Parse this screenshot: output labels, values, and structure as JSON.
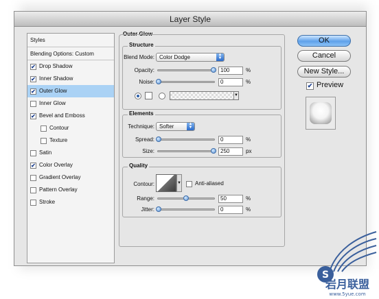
{
  "window": {
    "title": "Layer Style"
  },
  "styles_panel": {
    "header": "Styles",
    "blending_options": "Blending Options: Custom",
    "items": [
      {
        "label": "Drop Shadow",
        "checked": true,
        "indent": false,
        "selected": false
      },
      {
        "label": "Inner Shadow",
        "checked": true,
        "indent": false,
        "selected": false
      },
      {
        "label": "Outer Glow",
        "checked": true,
        "indent": false,
        "selected": true
      },
      {
        "label": "Inner Glow",
        "checked": false,
        "indent": false,
        "selected": false
      },
      {
        "label": "Bevel and Emboss",
        "checked": true,
        "indent": false,
        "selected": false
      },
      {
        "label": "Contour",
        "checked": false,
        "indent": true,
        "selected": false
      },
      {
        "label": "Texture",
        "checked": false,
        "indent": true,
        "selected": false
      },
      {
        "label": "Satin",
        "checked": false,
        "indent": false,
        "selected": false
      },
      {
        "label": "Color Overlay",
        "checked": true,
        "indent": false,
        "selected": false
      },
      {
        "label": "Gradient Overlay",
        "checked": false,
        "indent": false,
        "selected": false
      },
      {
        "label": "Pattern Overlay",
        "checked": false,
        "indent": false,
        "selected": false
      },
      {
        "label": "Stroke",
        "checked": false,
        "indent": false,
        "selected": false
      }
    ]
  },
  "outer_glow": {
    "title": "Outer Glow",
    "structure": {
      "title": "Structure",
      "blend_mode_label": "Blend Mode:",
      "blend_mode_value": "Color Dodge",
      "opacity_label": "Opacity:",
      "opacity_value": "100",
      "opacity_level": 1.0,
      "noise_label": "Noise:",
      "noise_value": "0",
      "noise_level": 0.0,
      "percent": "%"
    },
    "elements": {
      "title": "Elements",
      "technique_label": "Technique:",
      "technique_value": "Softer",
      "spread_label": "Spread:",
      "spread_value": "0",
      "spread_level": 0.0,
      "size_label": "Size:",
      "size_value": "250",
      "size_level": 1.0,
      "percent": "%",
      "px": "px"
    },
    "quality": {
      "title": "Quality",
      "contour_label": "Contour:",
      "anti_aliased_label": "Anti-aliased",
      "anti_aliased": false,
      "range_label": "Range:",
      "range_value": "50",
      "range_level": 0.5,
      "jitter_label": "Jitter:",
      "jitter_value": "0",
      "jitter_level": 0.0,
      "percent": "%"
    }
  },
  "buttons": {
    "ok": "OK",
    "cancel": "Cancel",
    "new_style": "New Style...",
    "preview_label": "Preview",
    "preview_checked": true
  },
  "watermark": {
    "text": "岩月联盟",
    "url_text": "www.5yue.com"
  },
  "colors": {
    "selection": "#aad2f5",
    "accent": "#5fa1ea",
    "watermark": "#3a5f9c"
  }
}
